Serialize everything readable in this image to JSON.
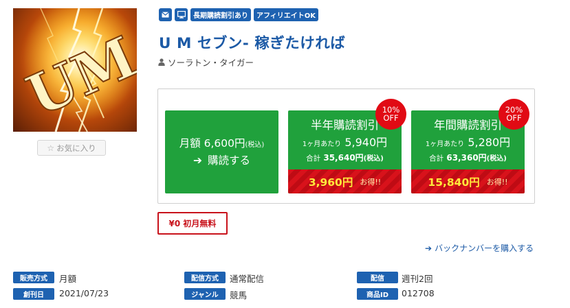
{
  "image": {
    "logo_text": "UM"
  },
  "favorite_label": "お気に入り",
  "tags": {
    "tag1": "長期購読割引あり",
    "tag2": "アフィリエイトOK"
  },
  "title": "U M セブン- 稼ぎたければ",
  "author": "ソーラトン・タイガー",
  "plans": {
    "monthly": {
      "label": "月額 6,600円",
      "tax": "(税込)",
      "cta": "購読する"
    },
    "half": {
      "name": "半年購読割引",
      "per_label": "1ヶ月あたり",
      "per_price": "5,940円",
      "total_label": "合計",
      "total": "35,640円",
      "tax": "(税込)",
      "savings": "3,960円",
      "otoku": "お得!!",
      "badge_pct": "10%",
      "badge_off": "OFF"
    },
    "annual": {
      "name": "年間購読割引",
      "per_label": "1ヶ月あたり",
      "per_price": "5,280円",
      "total_label": "合計",
      "total": "63,360円",
      "tax": "(税込)",
      "savings": "15,840円",
      "otoku": "お得!!",
      "badge_pct": "20%",
      "badge_off": "OFF"
    }
  },
  "free_month": "¥0 初月無料",
  "backnumber": "バックナンバーを購入する",
  "info": {
    "sales_method": {
      "label": "販売方式",
      "value": "月額"
    },
    "created": {
      "label": "創刊日",
      "value": "2021/07/23"
    },
    "delivery_method": {
      "label": "配信方式",
      "value": "通常配信"
    },
    "genre": {
      "label": "ジャンル",
      "value": "競馬"
    },
    "delivery": {
      "label": "配信",
      "value": "週刊2回"
    },
    "product_id": {
      "label": "商品ID",
      "value": "012708"
    }
  },
  "colors": {
    "accent_blue": "#1e62b1",
    "plan_green": "#20a13c",
    "savings_red": "#d8121b",
    "title_blue": "#1c5aa6"
  }
}
